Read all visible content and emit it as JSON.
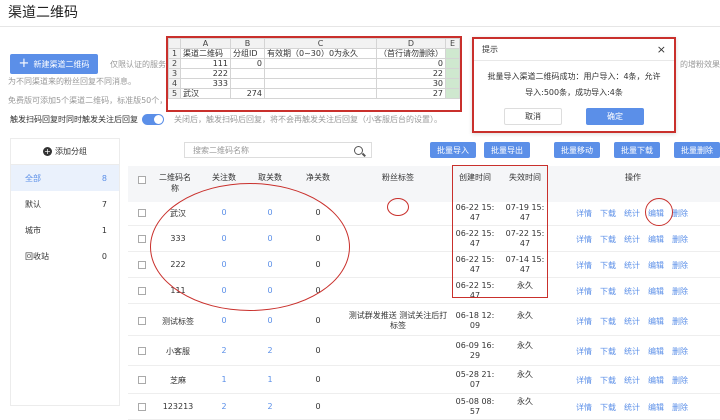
{
  "page": {
    "title": "渠道二维码"
  },
  "toolbar": {
    "new_label": "新建渠道二维码",
    "desc1": "仅限认证的服务",
    "desc1_right": "的增粉效果，",
    "desc2": "为不同渠道来的粉丝回复不同消息。",
    "desc3": "免费版可添加5个渠道二维码，标准版50个，",
    "toggle_label": "触发扫码回复时同时触发关注后回复",
    "toggle_desc": "关闭后，触发扫码后回复，将不会再触发关注后回复（小客服后台的设置）。"
  },
  "excel": {
    "columns": [
      "",
      "A",
      "B",
      "C",
      "D",
      "E"
    ],
    "rows": [
      [
        "1",
        "渠道二维码",
        "分组ID",
        "有效期（0~30）0为永久",
        "（首行请勿删除）",
        ""
      ],
      [
        "2",
        "111",
        "0",
        "",
        "0",
        ""
      ],
      [
        "3",
        "222",
        "",
        "",
        "22",
        ""
      ],
      [
        "4",
        "333",
        "",
        "",
        "30",
        ""
      ],
      [
        "5",
        "武汉",
        "274",
        "",
        "27",
        ""
      ]
    ]
  },
  "dialog": {
    "title": "提示",
    "close": "×",
    "message": "批量导入渠道二维码成功：用户导入：4条，允许导入:500条，成功导入:4条",
    "cancel": "取消",
    "ok": "确定"
  },
  "sidebar": {
    "add_label": "添加分组",
    "items": [
      {
        "label": "全部",
        "count": "8"
      },
      {
        "label": "默认",
        "count": "7"
      },
      {
        "label": "城市",
        "count": "1"
      },
      {
        "label": "回收站",
        "count": "0"
      }
    ]
  },
  "search": {
    "placeholder": "搜索二维码名称"
  },
  "actions": [
    "批量导入",
    "批量导出",
    "批量移动",
    "批量下载",
    "批量删除"
  ],
  "table": {
    "headers": [
      "二维码名\n称",
      "关注数",
      "取关数",
      "净关数",
      "粉丝标签",
      "创建时间",
      "失效时间",
      "操作"
    ],
    "ops": [
      "详情",
      "下载",
      "统计",
      "编辑",
      "删除"
    ],
    "rows": [
      {
        "name": "武汉",
        "follow": "0",
        "unfollow": "0",
        "net": "0",
        "tag": "",
        "created": "06-22 15:\n47",
        "expire": "07-19 15:\n47"
      },
      {
        "name": "333",
        "follow": "0",
        "unfollow": "0",
        "net": "0",
        "tag": "",
        "created": "06-22 15:\n47",
        "expire": "07-22 15:\n47"
      },
      {
        "name": "222",
        "follow": "0",
        "unfollow": "0",
        "net": "0",
        "tag": "",
        "created": "06-22 15:\n47",
        "expire": "07-14 15:\n47"
      },
      {
        "name": "111",
        "follow": "0",
        "unfollow": "0",
        "net": "0",
        "tag": "",
        "created": "06-22 15:\n47",
        "expire": "永久"
      },
      {
        "name": "测试标签",
        "follow": "0",
        "unfollow": "0",
        "net": "0",
        "tag": "测试群发推送 测试关注后打\n标签",
        "created": "06-18 12:\n09",
        "expire": "永久"
      },
      {
        "name": "小客服",
        "follow": "2",
        "unfollow": "2",
        "net": "0",
        "tag": "",
        "created": "06-09 16:\n29",
        "expire": "永久"
      },
      {
        "name": "芝麻",
        "follow": "1",
        "unfollow": "1",
        "net": "0",
        "tag": "",
        "created": "05-28 21:\n07",
        "expire": "永久"
      },
      {
        "name": "123213",
        "follow": "2",
        "unfollow": "2",
        "net": "0",
        "tag": "",
        "created": "05-08 08:\n57",
        "expire": "永久"
      }
    ]
  },
  "colors": {
    "accent": "#5b8fe8",
    "annotation": "#c9302c"
  }
}
